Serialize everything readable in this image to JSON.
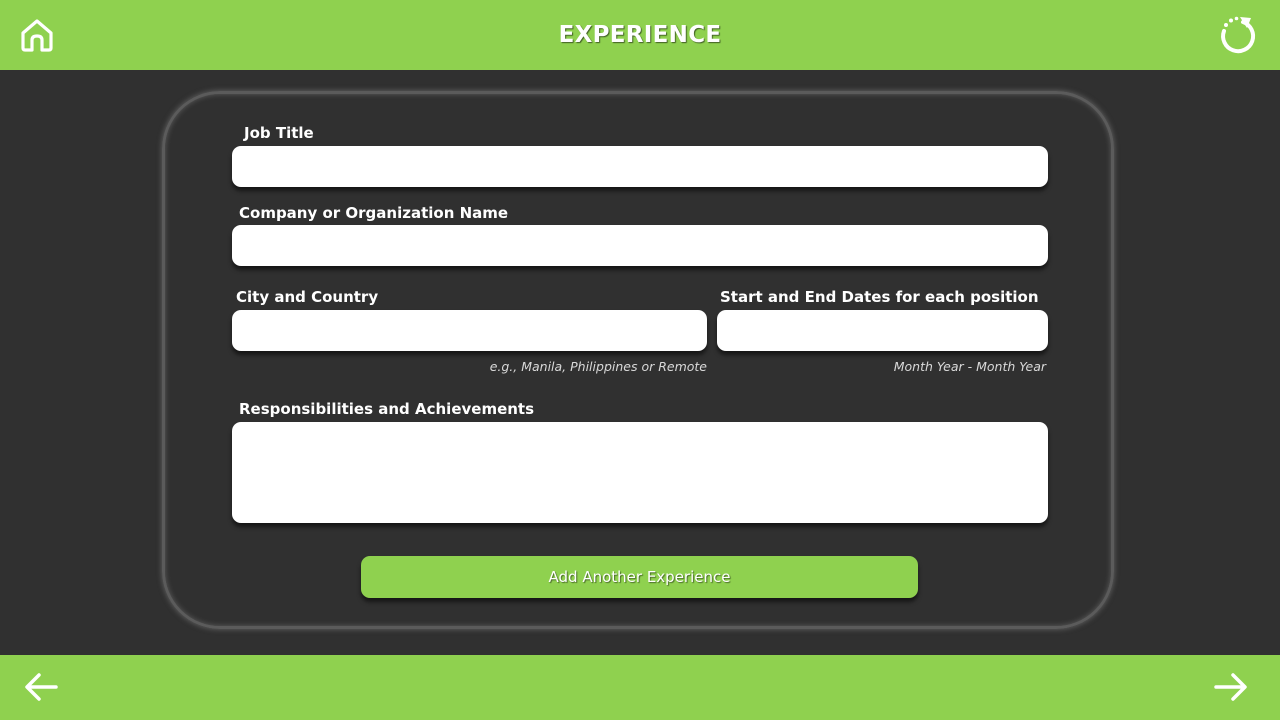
{
  "header": {
    "title": "EXPERIENCE",
    "home_icon": "home-icon",
    "reset_icon": "refresh-icon"
  },
  "form": {
    "job_title_label": "Job Title",
    "job_title_value": "",
    "company_label": "Company or Organization Name",
    "company_value": "",
    "city_label": "City and Country",
    "city_value": "",
    "city_hint": "e.g., Manila, Philippines or Remote",
    "dates_label": "Start and End Dates for each position",
    "dates_value": "",
    "dates_hint": "Month Year - Month Year",
    "responsibilities_label": "Responsibilities and Achievements",
    "responsibilities_value": "",
    "add_button_label": "Add Another Experience"
  },
  "footer": {
    "back_icon": "arrow-left-icon",
    "next_icon": "arrow-right-icon"
  },
  "colors": {
    "accent": "#8fd14f",
    "background": "#303030",
    "field": "#ffffff"
  }
}
